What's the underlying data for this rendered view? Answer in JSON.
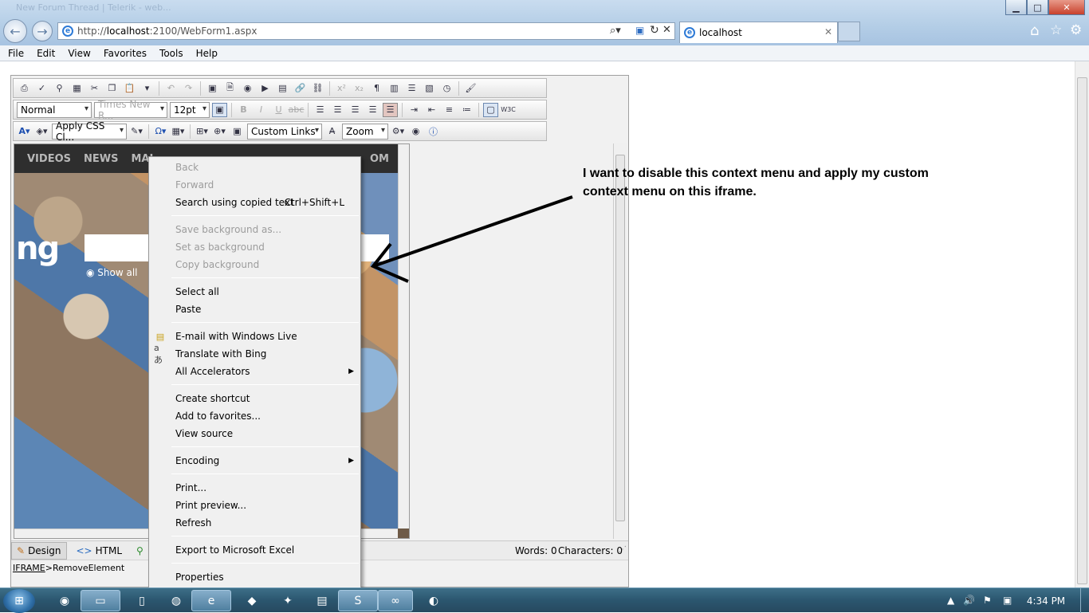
{
  "browser": {
    "window_title": "New Forum Thread | Telerik - web...",
    "address": {
      "prefix": "http://",
      "host": "localhost",
      "rest": ":2100/WebForm1.aspx"
    },
    "tab_title": "localhost",
    "window_buttons": {
      "minimize": "▁",
      "maximize": "□",
      "close": "✕"
    },
    "nav": {
      "back": "←",
      "forward": "→"
    },
    "menu": [
      "File",
      "Edit",
      "View",
      "Favorites",
      "Tools",
      "Help"
    ]
  },
  "editor": {
    "style_select": "Normal",
    "font_select": "Times New R...",
    "size_select": "12pt",
    "css_select": "Apply CSS Cl...",
    "custom_links": "Custom Links",
    "zoom": "Zoom",
    "iframe_nav": [
      "VIDEOS",
      "NEWS",
      "MAI",
      "OM"
    ],
    "iframe_logo": "ng",
    "iframe_showall": "Show all",
    "modes": {
      "design": "Design",
      "html": "HTML"
    },
    "status": {
      "words": "Words: 0",
      "characters": "Characters: 0"
    },
    "path": {
      "tag": "IFRAME",
      "sep": " > ",
      "item": "RemoveElement"
    }
  },
  "context_menu": {
    "items": [
      {
        "label": "Back",
        "disabled": true
      },
      {
        "label": "Forward",
        "disabled": true
      },
      {
        "label": "Search using copied text",
        "shortcut": "Ctrl+Shift+L"
      },
      {
        "label": "Save background as...",
        "disabled": true
      },
      {
        "label": "Set as background",
        "disabled": true
      },
      {
        "label": "Copy background",
        "disabled": true
      },
      {
        "label": "Select all"
      },
      {
        "label": "Paste"
      },
      {
        "label": "E-mail with Windows Live",
        "icon": "mail-icon"
      },
      {
        "label": "Translate with Bing",
        "icon": "translate-icon"
      },
      {
        "label": "All Accelerators",
        "submenu": true
      },
      {
        "label": "Create shortcut"
      },
      {
        "label": "Add to favorites..."
      },
      {
        "label": "View source"
      },
      {
        "label": "Encoding",
        "submenu": true
      },
      {
        "label": "Print..."
      },
      {
        "label": "Print preview..."
      },
      {
        "label": "Refresh"
      },
      {
        "label": "Export to Microsoft Excel"
      },
      {
        "label": "Properties"
      }
    ]
  },
  "annotation": {
    "line1": "I want to disable this context menu and apply my custom",
    "line2": "context menu on this iframe."
  },
  "taskbar": {
    "time": "4:34 PM",
    "apps": [
      "chrome-icon",
      "explorer-icon",
      "notepad-icon",
      "firefox-icon",
      "ie-icon",
      "app-icon",
      "paint-icon",
      "notes-icon",
      "skype-icon",
      "visual-studio-icon",
      "chrome-app-icon"
    ]
  }
}
